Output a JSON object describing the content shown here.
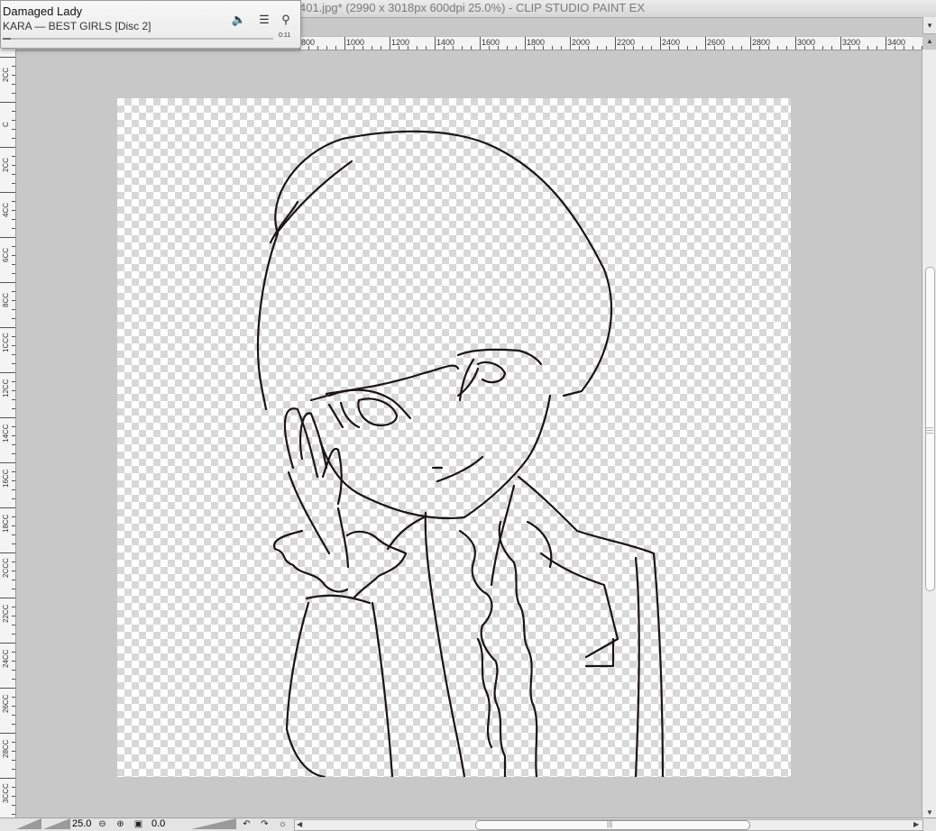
{
  "window": {
    "title": "401.jpg* (2990 x 3018px 600dpi 25.0%)  - CLIP STUDIO PAINT EX"
  },
  "ruler": {
    "h_labels": [
      "800",
      "1000",
      "1200",
      "1400",
      "1600",
      "1800",
      "2000",
      "2200",
      "2400",
      "2600",
      "2800",
      "3000",
      "3200",
      "3400"
    ],
    "v_labels": [
      "2CC",
      "C",
      "2CC",
      "4CC",
      "6CC",
      "8CC",
      "1CCC",
      "12CC",
      "14CC",
      "16CC",
      "18CC",
      "2CCC",
      "22CC",
      "24CC",
      "26CC",
      "28CC",
      "3CCC"
    ]
  },
  "status": {
    "zoom": "25.0",
    "rotation": "0.0"
  },
  "player": {
    "song": "Damaged Lady",
    "artist": "KARA — BEST GIRLS [Disc 2]",
    "elapsed": "0:11",
    "progress": 0.03
  },
  "icons": {
    "volume": "speaker-icon",
    "list": "list-icon",
    "search": "search-icon"
  }
}
